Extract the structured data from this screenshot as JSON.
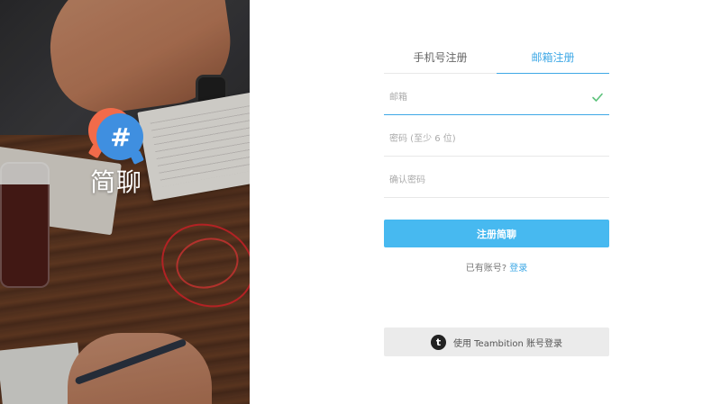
{
  "brand": {
    "name": "简聊",
    "logo_symbol": "#",
    "colors": {
      "orange": "#f26b4a",
      "blue": "#3f8fe0"
    }
  },
  "tabs": [
    {
      "label": "手机号注册",
      "active": false
    },
    {
      "label": "邮箱注册",
      "active": true
    }
  ],
  "fields": {
    "email": {
      "placeholder": "邮箱",
      "value": "",
      "valid": true
    },
    "password": {
      "placeholder": "密码 (至少 6 位)",
      "value": ""
    },
    "confirm": {
      "placeholder": "确认密码",
      "value": ""
    }
  },
  "submit_label": "注册简聊",
  "login_prompt": {
    "text": "已有账号?",
    "link": "登录"
  },
  "teambition": {
    "icon_letter": "t",
    "label": "使用 Teambition 账号登录"
  },
  "accent_color": "#3ea8e6"
}
